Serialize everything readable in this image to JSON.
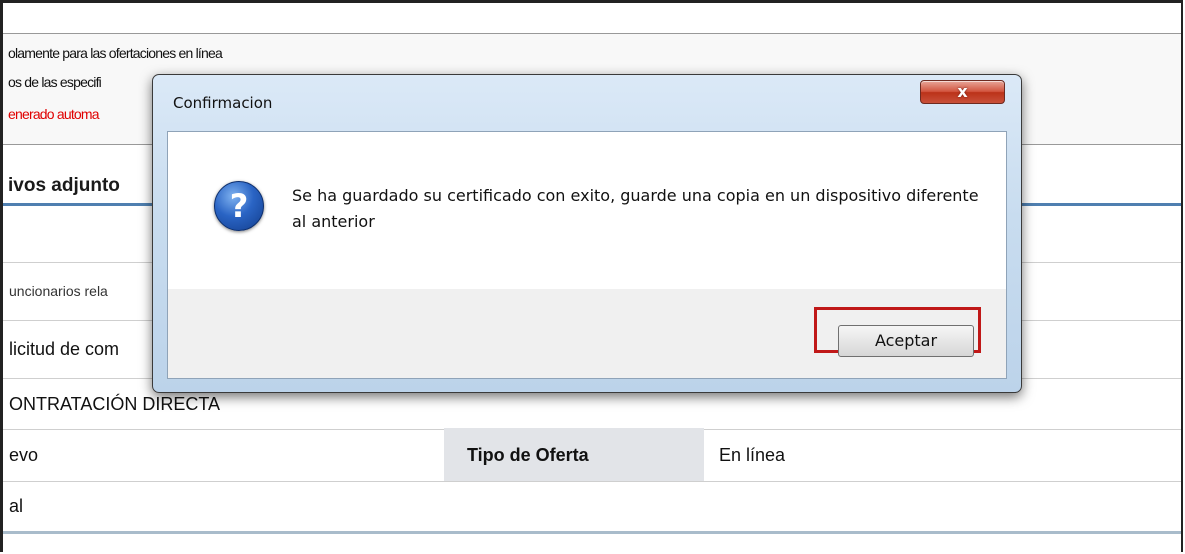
{
  "background": {
    "notes": [
      "olamente para las ofertaciones en línea",
      "os de las especifi",
      "enerado automa"
    ],
    "section_title": "ivos adjunto",
    "rows": {
      "funcionarios": "uncionarios rela",
      "solicitud": "licitud de com",
      "contratacion": "ONTRATACIÓN DIRECTA",
      "nuevo": "evo",
      "tipo_label": "Tipo de Oferta",
      "tipo_value": "En línea",
      "last": "al"
    },
    "colors": {
      "note_red": "#e00000",
      "section_rule": "#4f7fb0"
    }
  },
  "dialog": {
    "title": "Confirmacion",
    "close_label": "x",
    "icon": "question-icon",
    "message": "Se ha guardado su certificado con exito,  guarde una copia en un dispositivo diferente al anterior",
    "ok_label": "Aceptar",
    "colors": {
      "highlight": "#c01818",
      "close_button": "#c9503a"
    }
  }
}
